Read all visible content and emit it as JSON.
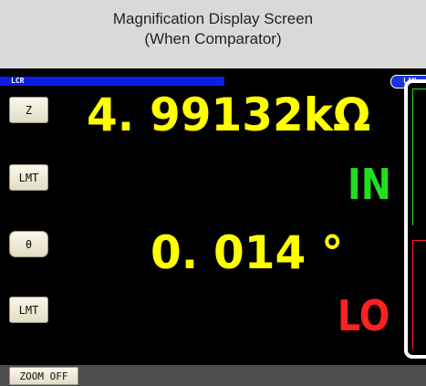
{
  "caption": {
    "line1": "Magnification Display Screen",
    "line2": "(When Comparator)"
  },
  "screen": {
    "mode": "LCR",
    "lan": "LAN",
    "param1": {
      "button": "Z",
      "value": "4. 99132kΩ",
      "limit_button": "LMT",
      "judgment": "IN",
      "judgment_color": "#22dd22"
    },
    "param2": {
      "button": "θ",
      "value": "0. 014  °",
      "limit_button": "LMT",
      "judgment": "LO",
      "judgment_color": "#ff2020"
    },
    "zoom_button": "ZOOM OFF",
    "colors": {
      "value": "#ffff00",
      "background": "#000000",
      "button": "#efe9d4",
      "status_bar": "#0a1ee6"
    }
  }
}
